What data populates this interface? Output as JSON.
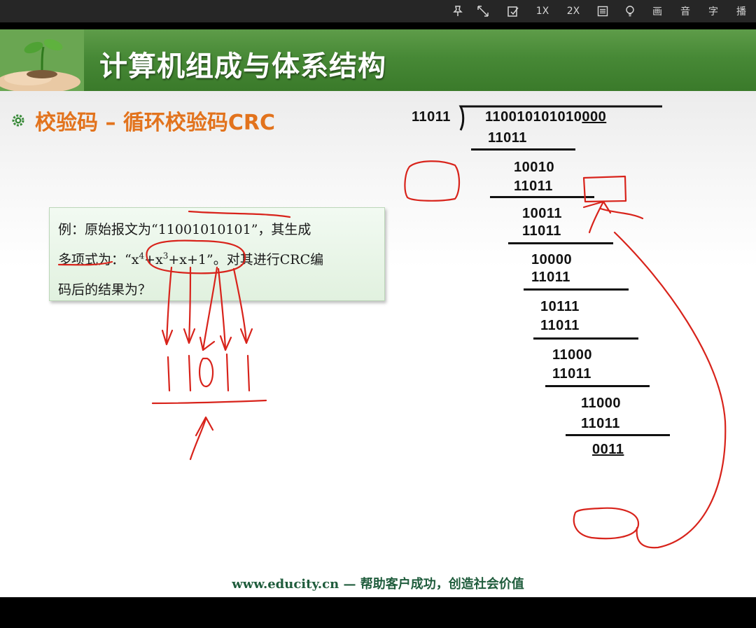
{
  "toolbar": {
    "items": [
      {
        "name": "pin-icon",
        "label": ""
      },
      {
        "name": "fullscreen-icon",
        "label": ""
      },
      {
        "name": "note-icon",
        "label": ""
      },
      {
        "name": "speed-1x-button",
        "label": "1X"
      },
      {
        "name": "speed-2x-button",
        "label": "2X"
      },
      {
        "name": "list-icon",
        "label": ""
      },
      {
        "name": "bulb-icon",
        "label": ""
      },
      {
        "name": "picture-button",
        "label": "画"
      },
      {
        "name": "audio-button",
        "label": "音"
      },
      {
        "name": "subtitle-button",
        "label": "字"
      },
      {
        "name": "play-button",
        "label": "播"
      }
    ]
  },
  "slide": {
    "title": "计算机组成与体系结构",
    "subtitle": "校验码 – 循环校验码CRC",
    "example": {
      "line1_a": "例：原始报文为“",
      "line1_b": "11001010101",
      "line1_c": "”，其生成",
      "line2_a": "多项式为：“",
      "poly_x1": "x",
      "poly_e1": "4",
      "poly_p1": "+x",
      "poly_e2": "3",
      "poly_rest": "+x+1",
      "line2_c": "”。对其进行CRC编",
      "line3": "码后的结果为？"
    },
    "division": {
      "divisor": "11011",
      "dividend_main": "110010101010",
      "dividend_pad": "000",
      "steps": [
        "11011",
        "10010",
        "11011",
        "10011",
        "11011",
        "10000",
        "11011",
        "10111",
        "11011",
        "11000",
        "11011",
        "11000",
        "11011"
      ],
      "remainder": "0011"
    },
    "footer": {
      "url": "www.educity.cn",
      "dash": "—",
      "slogan": "帮助客户成功，创造社会价值"
    }
  },
  "colors": {
    "banner": "#478936",
    "title_text": "#ffffff",
    "subtitle_text": "#e2731d",
    "footer_text": "#1f5c3c",
    "ink": "#d8231b"
  }
}
